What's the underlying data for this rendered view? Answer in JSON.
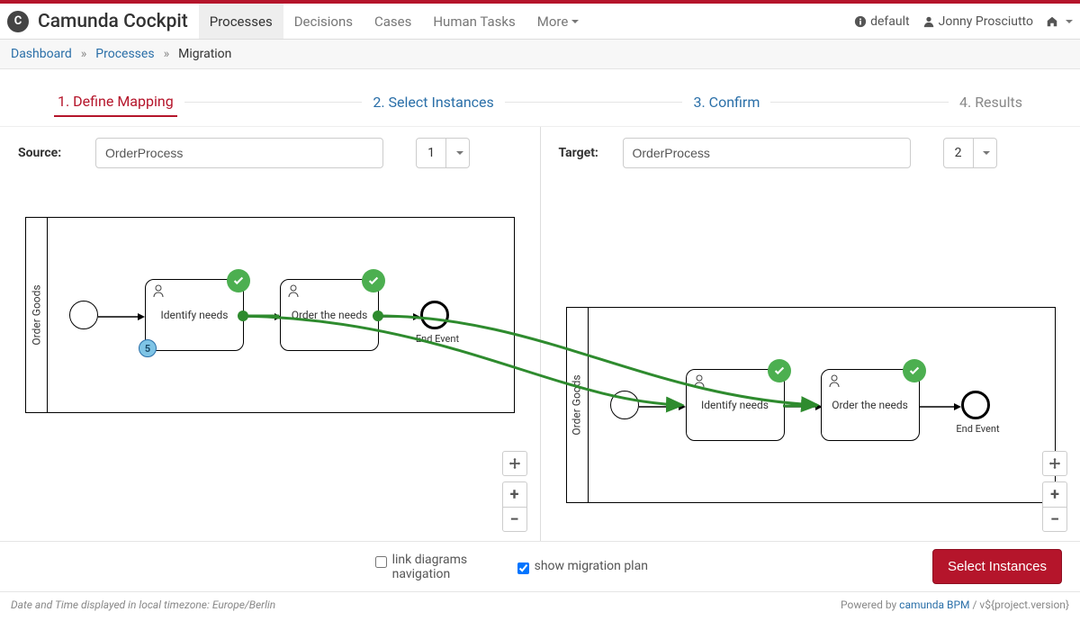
{
  "brand": "Camunda Cockpit",
  "nav": {
    "processes": "Processes",
    "decisions": "Decisions",
    "cases": "Cases",
    "humanTasks": "Human Tasks",
    "more": "More"
  },
  "headerRight": {
    "engine": "default",
    "user": "Jonny Prosciutto"
  },
  "breadcrumb": {
    "dashboard": "Dashboard",
    "processes": "Processes",
    "current": "Migration"
  },
  "wizard": {
    "step1": "1. Define Mapping",
    "step2": "2. Select Instances",
    "step3": "3. Confirm",
    "step4": "4. Results"
  },
  "source": {
    "label": "Source:",
    "process": "OrderProcess",
    "version": "1",
    "poolLabel": "Order Goods",
    "task1": "Identify needs",
    "task2": "Order the needs",
    "endLabel": "End Event",
    "instanceCount": "5"
  },
  "target": {
    "label": "Target:",
    "process": "OrderProcess",
    "version": "2",
    "poolLabel": "Order Goods",
    "task1": "Identify needs",
    "task2": "Order the needs",
    "endLabel": "End Event"
  },
  "options": {
    "link": "link diagrams navigation",
    "showPlan": "show migration plan"
  },
  "actions": {
    "next": "Select Instances"
  },
  "footer": {
    "tzPrefix": "Date and Time displayed in local timezone: ",
    "tz": "Europe/Berlin",
    "poweredPrefix": "Powered by ",
    "poweredLink": "camunda BPM",
    "versionSuffix": " / v${project.version}"
  }
}
